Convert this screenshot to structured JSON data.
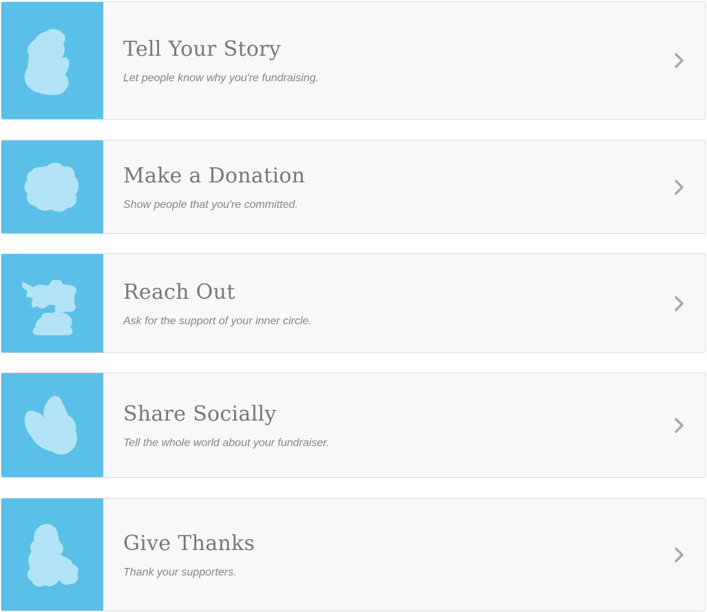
{
  "accent_color": "#5bc0e7",
  "steps": [
    {
      "title": "Tell Your Story",
      "subtitle": "Let people know why you're fundraising.",
      "icon": "storyteller-icon"
    },
    {
      "title": "Make a Donation",
      "subtitle": "Show people that you're committed.",
      "icon": "donation-icon"
    },
    {
      "title": "Reach Out",
      "subtitle": "Ask for the support of your inner circle.",
      "icon": "megaphone-icon"
    },
    {
      "title": "Share Socially",
      "subtitle": "Tell the whole world about your fundraiser.",
      "icon": "share-icon"
    },
    {
      "title": "Give Thanks",
      "subtitle": "Thank your supporters.",
      "icon": "thanks-icon"
    }
  ]
}
